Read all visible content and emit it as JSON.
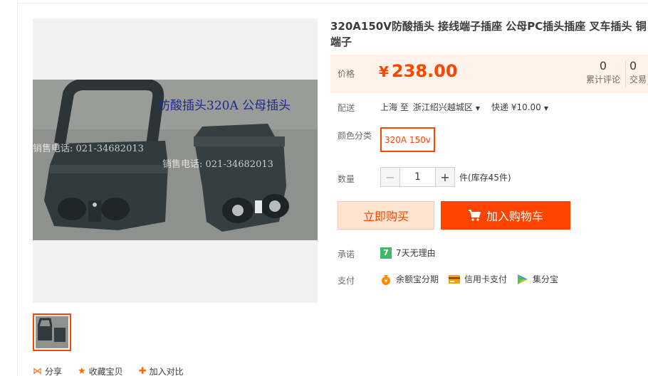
{
  "product": {
    "title": "320A150V防酸插头 接线端子插座 公母PC插头插座 叉车插头 铜端子",
    "image_text": "防酸插头320A  公母插头",
    "watermark_1": "销售电话: 021-34682013",
    "watermark_2": "销售电话: 021-34682013"
  },
  "price": {
    "label": "价格",
    "currency": "¥",
    "value": "238.00",
    "reviews_count": "0",
    "reviews_label": "累计评论",
    "trades_count": "0",
    "trades_label": "交易"
  },
  "delivery": {
    "label": "配送",
    "from": "上海 至",
    "to": "浙江绍兴越城区",
    "shipping": "快递 ¥10.00"
  },
  "sku": {
    "label": "颜色分类",
    "option": "320A 150v"
  },
  "quantity": {
    "label": "数量",
    "minus": "−",
    "value": "1",
    "plus": "+",
    "stock": "件(库存45件)"
  },
  "actions": {
    "buy_now": "立即购买",
    "add_to_cart": "加入购物车"
  },
  "promise": {
    "label": "承诺",
    "icon_text": "7",
    "text": "7天无理由"
  },
  "payment": {
    "label": "支付",
    "methods": [
      "余额宝分期",
      "信用卡支付",
      "集分宝"
    ]
  },
  "share": {
    "share": "分享",
    "favorite": "收藏宝贝",
    "compare": "加入对比"
  },
  "colors": {
    "accent": "#ff4400",
    "price_bg": "#fff2e8"
  }
}
